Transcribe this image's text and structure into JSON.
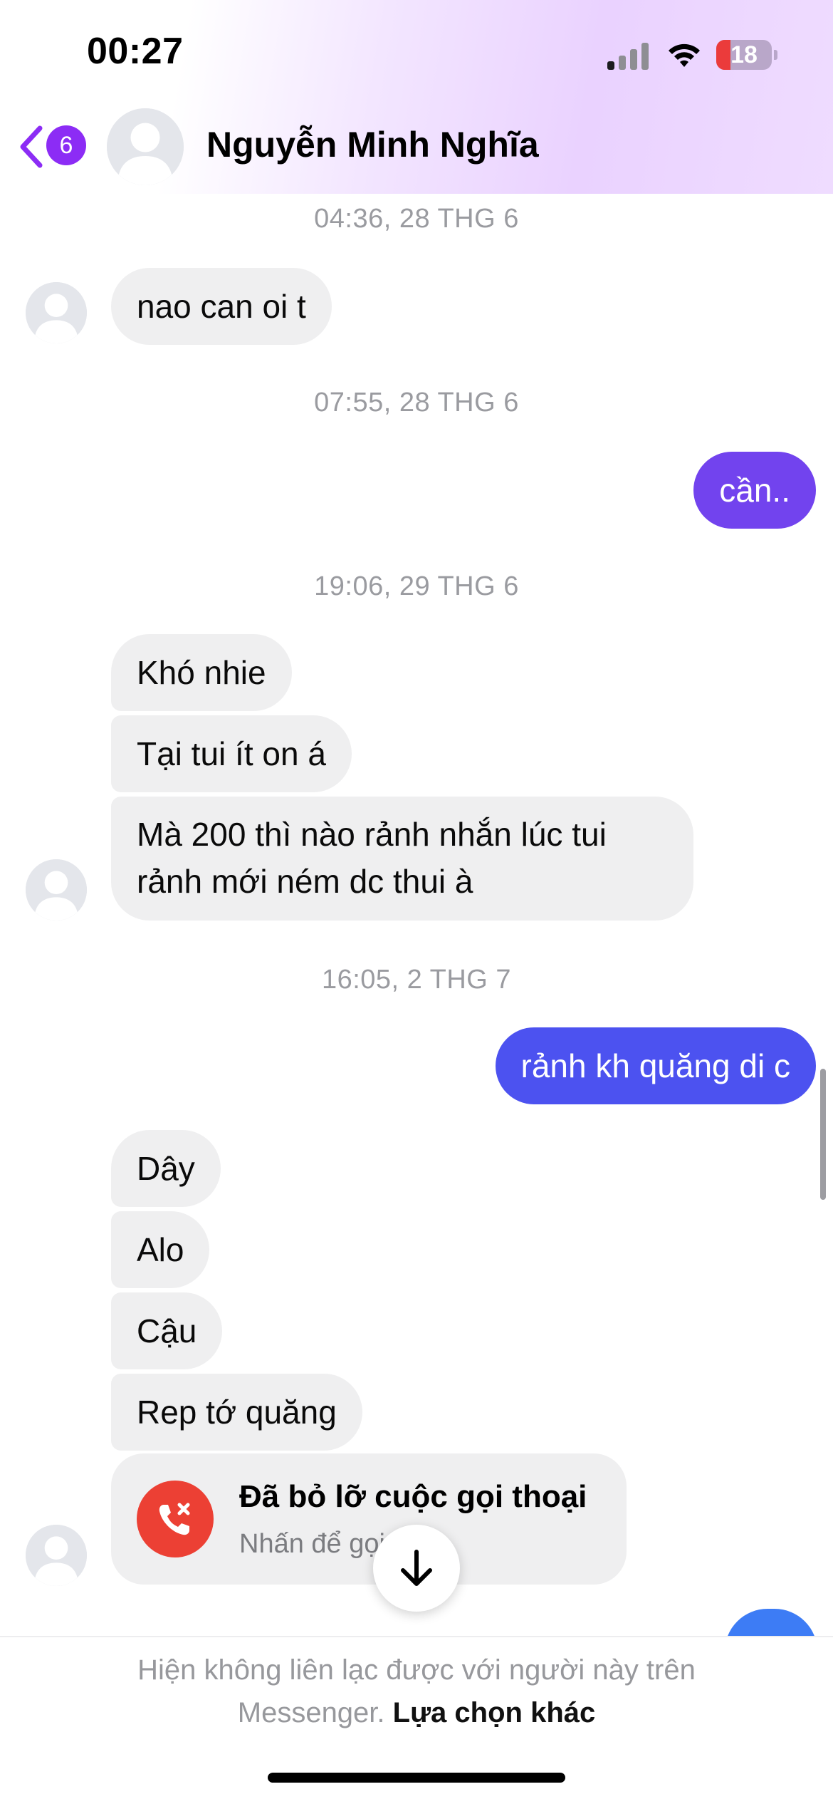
{
  "status_bar": {
    "time": "00:27",
    "battery": "18"
  },
  "header": {
    "unread_count": "6",
    "contact_name": "Nguyễn Minh Nghĩa"
  },
  "messages": {
    "ts1": "04:36, 28 THG 6",
    "m1": "nao can oi t",
    "ts2": "07:55, 28 THG 6",
    "m2": "cần..",
    "ts3": "19:06, 29 THG 6",
    "m3": "Khó nhie",
    "m4": "Tại tui ít on á",
    "m5_line1": "Mà 200 thì nào rảnh nhắn lúc tui",
    "m5_line2": "rảnh mới ném dc thui à",
    "ts4": "16:05, 2 THG 7",
    "m6": "rảnh kh quăng di c",
    "m7": "Dây",
    "m8": "Alo",
    "m9": "Cậu",
    "m10": "Rep tớ quăng",
    "call_title": "Đã bỏ lỡ cuộc gọi thoại",
    "call_subtitle": "Nhấn để gọi"
  },
  "footer": {
    "line1": "Hiện không liên lạc được với người này trên",
    "line2_prefix": "Messenger.",
    "line2_link": "Lựa chọn khác"
  },
  "colors": {
    "outgoing_purple": "#7243ee",
    "outgoing_blue": "#4c52f0",
    "incoming_gray": "#efeff0",
    "missed_call_red": "#ec4034",
    "badge_purple": "#8c2cf5"
  },
  "icons": [
    "back-chevron-icon",
    "missed-call-icon",
    "arrow-down-icon",
    "wifi-icon",
    "signal-icon",
    "battery-icon"
  ]
}
